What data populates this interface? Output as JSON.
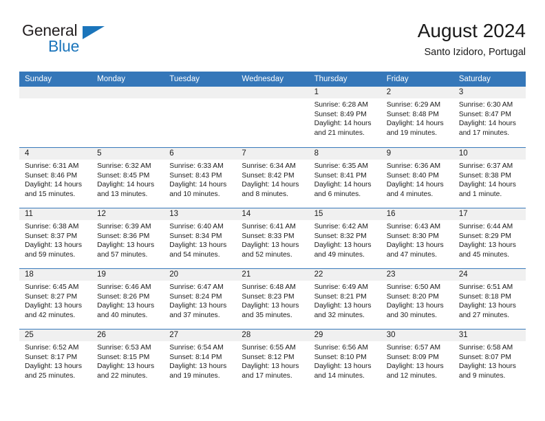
{
  "brand": {
    "word1": "General",
    "word2": "Blue",
    "accent_color": "#1b75bb",
    "triangle_icon": "brand-triangle-icon"
  },
  "header": {
    "title": "August 2024",
    "subtitle": "Santo Izidoro, Portugal"
  },
  "calendar": {
    "header_bg": "#3577b9",
    "day_strip_bg": "#f0f0f0",
    "weekdays": [
      "Sunday",
      "Monday",
      "Tuesday",
      "Wednesday",
      "Thursday",
      "Friday",
      "Saturday"
    ],
    "weeks": [
      [
        {
          "empty": true
        },
        {
          "empty": true
        },
        {
          "empty": true
        },
        {
          "empty": true
        },
        {
          "day": "1",
          "sunrise": "Sunrise: 6:28 AM",
          "sunset": "Sunset: 8:49 PM",
          "daylight1": "Daylight: 14 hours",
          "daylight2": "and 21 minutes."
        },
        {
          "day": "2",
          "sunrise": "Sunrise: 6:29 AM",
          "sunset": "Sunset: 8:48 PM",
          "daylight1": "Daylight: 14 hours",
          "daylight2": "and 19 minutes."
        },
        {
          "day": "3",
          "sunrise": "Sunrise: 6:30 AM",
          "sunset": "Sunset: 8:47 PM",
          "daylight1": "Daylight: 14 hours",
          "daylight2": "and 17 minutes."
        }
      ],
      [
        {
          "day": "4",
          "sunrise": "Sunrise: 6:31 AM",
          "sunset": "Sunset: 8:46 PM",
          "daylight1": "Daylight: 14 hours",
          "daylight2": "and 15 minutes."
        },
        {
          "day": "5",
          "sunrise": "Sunrise: 6:32 AM",
          "sunset": "Sunset: 8:45 PM",
          "daylight1": "Daylight: 14 hours",
          "daylight2": "and 13 minutes."
        },
        {
          "day": "6",
          "sunrise": "Sunrise: 6:33 AM",
          "sunset": "Sunset: 8:43 PM",
          "daylight1": "Daylight: 14 hours",
          "daylight2": "and 10 minutes."
        },
        {
          "day": "7",
          "sunrise": "Sunrise: 6:34 AM",
          "sunset": "Sunset: 8:42 PM",
          "daylight1": "Daylight: 14 hours",
          "daylight2": "and 8 minutes."
        },
        {
          "day": "8",
          "sunrise": "Sunrise: 6:35 AM",
          "sunset": "Sunset: 8:41 PM",
          "daylight1": "Daylight: 14 hours",
          "daylight2": "and 6 minutes."
        },
        {
          "day": "9",
          "sunrise": "Sunrise: 6:36 AM",
          "sunset": "Sunset: 8:40 PM",
          "daylight1": "Daylight: 14 hours",
          "daylight2": "and 4 minutes."
        },
        {
          "day": "10",
          "sunrise": "Sunrise: 6:37 AM",
          "sunset": "Sunset: 8:38 PM",
          "daylight1": "Daylight: 14 hours",
          "daylight2": "and 1 minute."
        }
      ],
      [
        {
          "day": "11",
          "sunrise": "Sunrise: 6:38 AM",
          "sunset": "Sunset: 8:37 PM",
          "daylight1": "Daylight: 13 hours",
          "daylight2": "and 59 minutes."
        },
        {
          "day": "12",
          "sunrise": "Sunrise: 6:39 AM",
          "sunset": "Sunset: 8:36 PM",
          "daylight1": "Daylight: 13 hours",
          "daylight2": "and 57 minutes."
        },
        {
          "day": "13",
          "sunrise": "Sunrise: 6:40 AM",
          "sunset": "Sunset: 8:34 PM",
          "daylight1": "Daylight: 13 hours",
          "daylight2": "and 54 minutes."
        },
        {
          "day": "14",
          "sunrise": "Sunrise: 6:41 AM",
          "sunset": "Sunset: 8:33 PM",
          "daylight1": "Daylight: 13 hours",
          "daylight2": "and 52 minutes."
        },
        {
          "day": "15",
          "sunrise": "Sunrise: 6:42 AM",
          "sunset": "Sunset: 8:32 PM",
          "daylight1": "Daylight: 13 hours",
          "daylight2": "and 49 minutes."
        },
        {
          "day": "16",
          "sunrise": "Sunrise: 6:43 AM",
          "sunset": "Sunset: 8:30 PM",
          "daylight1": "Daylight: 13 hours",
          "daylight2": "and 47 minutes."
        },
        {
          "day": "17",
          "sunrise": "Sunrise: 6:44 AM",
          "sunset": "Sunset: 8:29 PM",
          "daylight1": "Daylight: 13 hours",
          "daylight2": "and 45 minutes."
        }
      ],
      [
        {
          "day": "18",
          "sunrise": "Sunrise: 6:45 AM",
          "sunset": "Sunset: 8:27 PM",
          "daylight1": "Daylight: 13 hours",
          "daylight2": "and 42 minutes."
        },
        {
          "day": "19",
          "sunrise": "Sunrise: 6:46 AM",
          "sunset": "Sunset: 8:26 PM",
          "daylight1": "Daylight: 13 hours",
          "daylight2": "and 40 minutes."
        },
        {
          "day": "20",
          "sunrise": "Sunrise: 6:47 AM",
          "sunset": "Sunset: 8:24 PM",
          "daylight1": "Daylight: 13 hours",
          "daylight2": "and 37 minutes."
        },
        {
          "day": "21",
          "sunrise": "Sunrise: 6:48 AM",
          "sunset": "Sunset: 8:23 PM",
          "daylight1": "Daylight: 13 hours",
          "daylight2": "and 35 minutes."
        },
        {
          "day": "22",
          "sunrise": "Sunrise: 6:49 AM",
          "sunset": "Sunset: 8:21 PM",
          "daylight1": "Daylight: 13 hours",
          "daylight2": "and 32 minutes."
        },
        {
          "day": "23",
          "sunrise": "Sunrise: 6:50 AM",
          "sunset": "Sunset: 8:20 PM",
          "daylight1": "Daylight: 13 hours",
          "daylight2": "and 30 minutes."
        },
        {
          "day": "24",
          "sunrise": "Sunrise: 6:51 AM",
          "sunset": "Sunset: 8:18 PM",
          "daylight1": "Daylight: 13 hours",
          "daylight2": "and 27 minutes."
        }
      ],
      [
        {
          "day": "25",
          "sunrise": "Sunrise: 6:52 AM",
          "sunset": "Sunset: 8:17 PM",
          "daylight1": "Daylight: 13 hours",
          "daylight2": "and 25 minutes."
        },
        {
          "day": "26",
          "sunrise": "Sunrise: 6:53 AM",
          "sunset": "Sunset: 8:15 PM",
          "daylight1": "Daylight: 13 hours",
          "daylight2": "and 22 minutes."
        },
        {
          "day": "27",
          "sunrise": "Sunrise: 6:54 AM",
          "sunset": "Sunset: 8:14 PM",
          "daylight1": "Daylight: 13 hours",
          "daylight2": "and 19 minutes."
        },
        {
          "day": "28",
          "sunrise": "Sunrise: 6:55 AM",
          "sunset": "Sunset: 8:12 PM",
          "daylight1": "Daylight: 13 hours",
          "daylight2": "and 17 minutes."
        },
        {
          "day": "29",
          "sunrise": "Sunrise: 6:56 AM",
          "sunset": "Sunset: 8:10 PM",
          "daylight1": "Daylight: 13 hours",
          "daylight2": "and 14 minutes."
        },
        {
          "day": "30",
          "sunrise": "Sunrise: 6:57 AM",
          "sunset": "Sunset: 8:09 PM",
          "daylight1": "Daylight: 13 hours",
          "daylight2": "and 12 minutes."
        },
        {
          "day": "31",
          "sunrise": "Sunrise: 6:58 AM",
          "sunset": "Sunset: 8:07 PM",
          "daylight1": "Daylight: 13 hours",
          "daylight2": "and 9 minutes."
        }
      ]
    ]
  }
}
